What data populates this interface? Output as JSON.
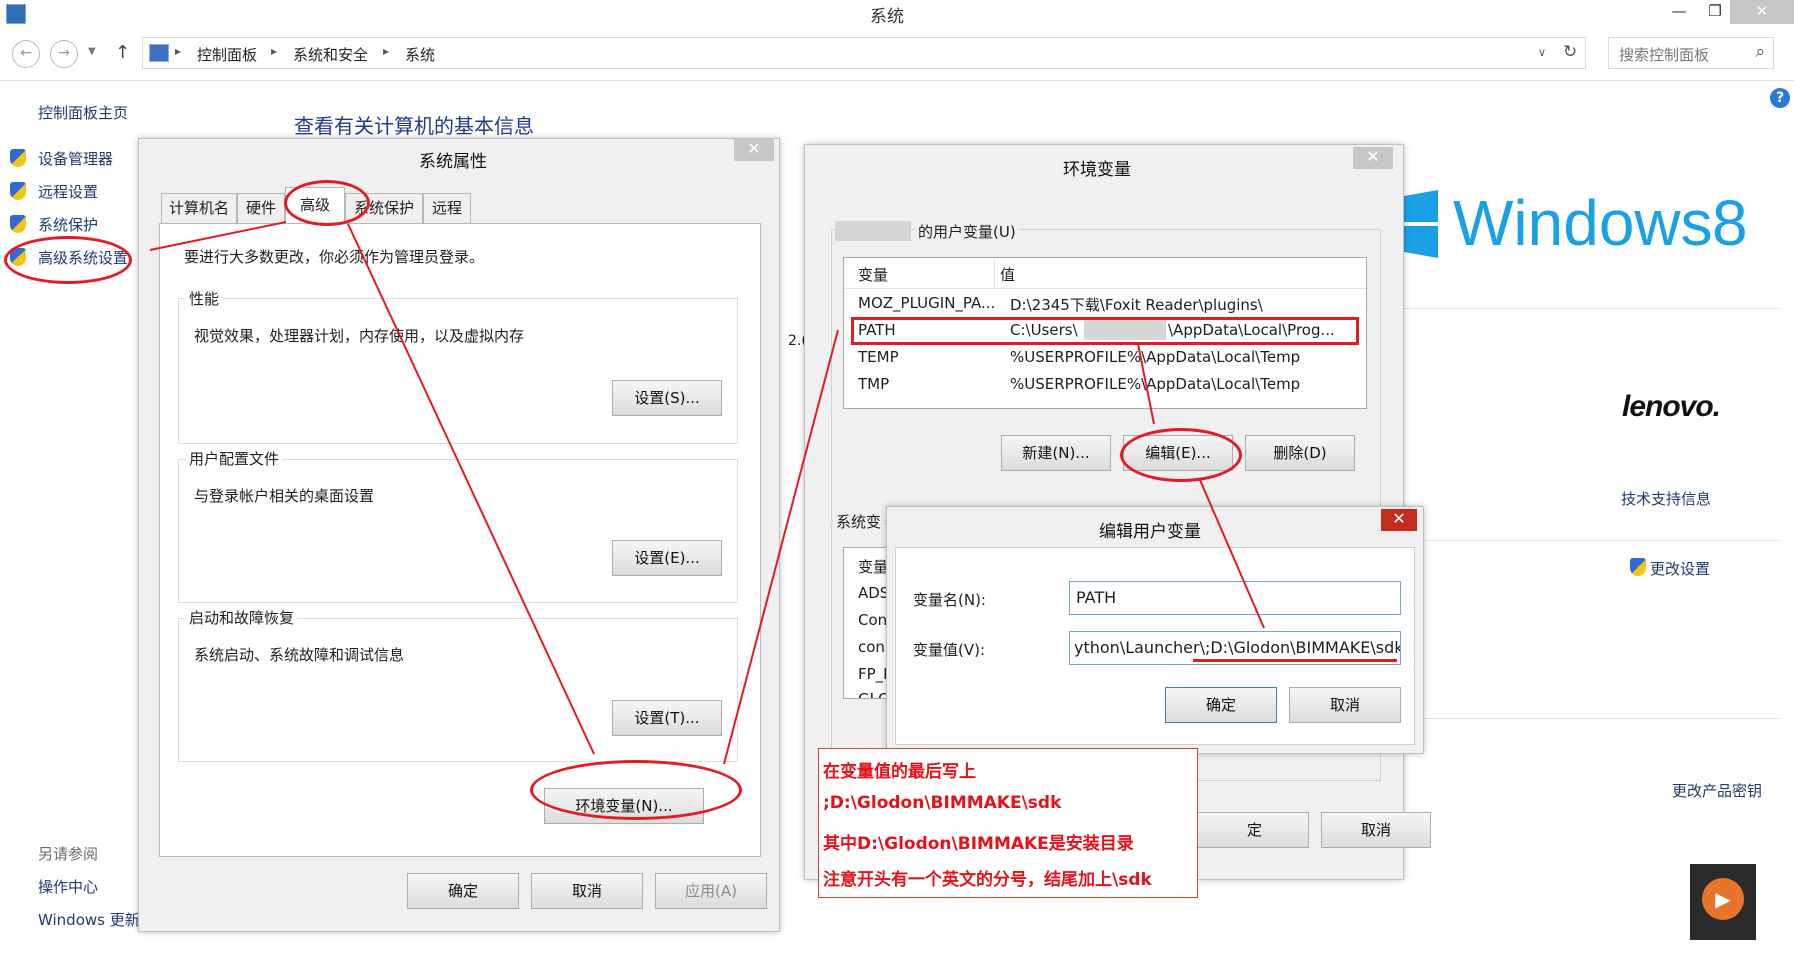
{
  "window": {
    "title": "系统",
    "controls": {
      "minimize": "—",
      "maximize": "❐",
      "close": "✕"
    }
  },
  "address": {
    "up": "↑",
    "crumbs": [
      "控制面板",
      "系统和安全",
      "系统"
    ],
    "search_placeholder": "搜索控制面板",
    "help": "?"
  },
  "left_nav": {
    "home": "控制面板主页",
    "items": [
      "设备管理器",
      "远程设置",
      "系统保护",
      "高级系统设置"
    ],
    "see_also_label": "另请参阅",
    "see_also": [
      "操作中心",
      "Windows 更新"
    ]
  },
  "main": {
    "heading": "查看有关计算机的基本信息",
    "partial_text": "2.(",
    "windows_logo": "Windows",
    "windows_version": "8",
    "lenovo": "lenovo.",
    "support_link": "技术支持信息",
    "change_settings": "更改设置",
    "change_key": "更改产品密钥"
  },
  "sys_props": {
    "title": "系统属性",
    "close": "✕",
    "tabs": [
      "计算机名",
      "硬件",
      "高级",
      "系统保护",
      "远程"
    ],
    "active_tab": "高级",
    "admin_note": "要进行大多数更改，你必须作为管理员登录。",
    "groups": [
      {
        "label": "性能",
        "desc": "视觉效果，处理器计划，内存使用，以及虚拟内存",
        "button": "设置(S)..."
      },
      {
        "label": "用户配置文件",
        "desc": "与登录帐户相关的桌面设置",
        "button": "设置(E)..."
      },
      {
        "label": "启动和故障恢复",
        "desc": "系统启动、系统故障和调试信息",
        "button": "设置(T)..."
      }
    ],
    "env_button": "环境变量(N)...",
    "ok": "确定",
    "cancel": "取消",
    "apply": "应用(A)"
  },
  "env_vars": {
    "title": "环境变量",
    "close": "✕",
    "user_group": "的用户变量(U)",
    "col_var": "变量",
    "col_val": "值",
    "user_rows": [
      {
        "var": "MOZ_PLUGIN_PA...",
        "val": "D:\\2345下载\\Foxit Reader\\plugins\\"
      },
      {
        "var": "PATH",
        "val_pre": "C:\\Users\\",
        "val_post": "\\AppData\\Local\\Prog..."
      },
      {
        "var": "TEMP",
        "val": "%USERPROFILE%\\AppData\\Local\\Temp"
      },
      {
        "var": "TMP",
        "val": "%USERPROFILE%\\AppData\\Local\\Temp"
      }
    ],
    "new_button": "新建(N)...",
    "edit_button": "编辑(E)...",
    "delete_button": "删除(D)",
    "sys_group": "系统变",
    "sys_col_var": "变量",
    "sys_rows": [
      "ADS",
      "Con",
      "con",
      "FP_N",
      "GLC"
    ],
    "ok_fragment": "定",
    "cancel": "取消"
  },
  "edit_var": {
    "title": "编辑用户变量",
    "close": "✕",
    "name_label": "变量名(N):",
    "name_value": "PATH",
    "value_label": "变量值(V):",
    "value_value": "ython\\Launcher\\;D:\\Glodon\\BIMMAKE\\sdk",
    "ok": "确定",
    "cancel": "取消"
  },
  "instruction": {
    "lines": [
      "在变量值的最后写上",
      ";D:\\Glodon\\BIMMAKE\\sdk",
      "其中D:\\Glodon\\BIMMAKE是安装目录",
      "注意开头有一个英文的分号，结尾加上\\sdk"
    ]
  },
  "colors": {
    "annotation": "#e31b23",
    "link": "#1e3c6e",
    "windows_blue": "#1aa0e6"
  }
}
